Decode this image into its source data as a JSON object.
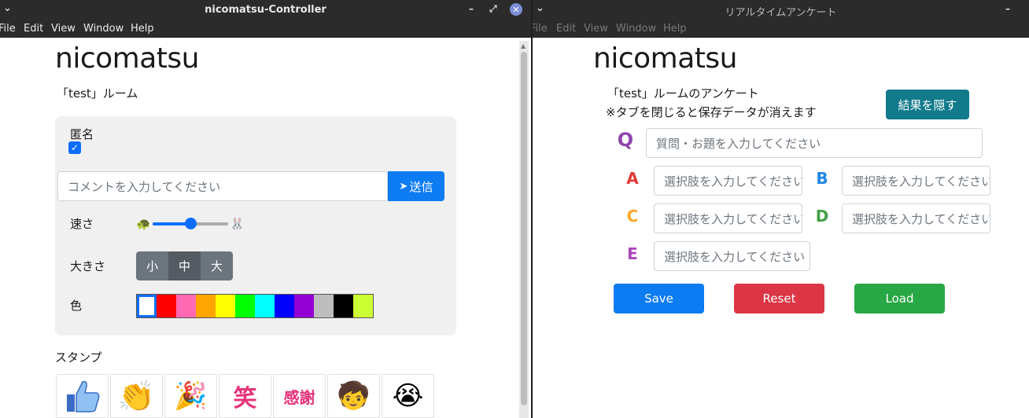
{
  "left": {
    "title": "nicomatsu-Controller",
    "menu": [
      "File",
      "Edit",
      "View",
      "Window",
      "Help"
    ],
    "logo": "nicomatsu",
    "room": "「test」ルーム",
    "anon_label": "匿名",
    "anon_checked": true,
    "comment_placeholder": "コメントを入力してください",
    "send_label": "送信",
    "speed_label": "速さ",
    "speed_value": 0.5,
    "size_label": "大きさ",
    "sizes": [
      "小",
      "中",
      "大"
    ],
    "size_selected": "中",
    "color_label": "色",
    "colors": [
      "#ffffff",
      "#ff0000",
      "#ff69b4",
      "#ffa500",
      "#ffff00",
      "#00ff00",
      "#00ffff",
      "#0000ff",
      "#9400d3",
      "#bdbdbd",
      "#000000",
      "#ccff33"
    ],
    "stamp_label": "スタンプ",
    "stamps": [
      "thumbs-up",
      "clapping-hands",
      "party-popper",
      "warai",
      "kansha",
      "boy-surprised",
      "boy-crying"
    ],
    "stamp_texts": {
      "warai": "笑",
      "kansha": "感謝"
    }
  },
  "right": {
    "title": "リアルタイムアンケート",
    "menu": [
      "File",
      "Edit",
      "View",
      "Window",
      "Help"
    ],
    "logo": "nicomatsu",
    "survey_title": "「test」ルームのアンケート",
    "warning": "※タブを閉じると保存データが消えます",
    "hide_label": "結果を隠す",
    "question_placeholder": "質問・お題を入力してください",
    "choice_placeholder": "選択肢を入力してください",
    "choices": [
      "A",
      "B",
      "C",
      "D",
      "E"
    ],
    "save_label": "Save",
    "reset_label": "Reset",
    "load_label": "Load"
  },
  "colors": {
    "primary": "#0d7bf2",
    "danger": "#dc3545",
    "success": "#28a745",
    "info": "#117a8b"
  }
}
